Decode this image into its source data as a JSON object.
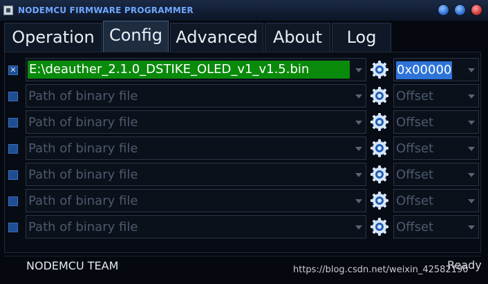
{
  "window": {
    "title": "NODEMCU FIRMWARE PROGRAMMER"
  },
  "tabs": [
    {
      "label": "Operation",
      "active": false
    },
    {
      "label": "Config",
      "active": true
    },
    {
      "label": "Advanced",
      "active": false
    },
    {
      "label": "About",
      "active": false
    },
    {
      "label": "Log",
      "active": false
    }
  ],
  "rows": [
    {
      "checked": true,
      "path": "E:\\deauther_2.1.0_DSTIKE_OLED_v1_v1.5.bin",
      "offset": "0x00000"
    },
    {
      "checked": false,
      "path": "Path of binary file",
      "offset": "Offset"
    },
    {
      "checked": false,
      "path": "Path of binary file",
      "offset": "Offset"
    },
    {
      "checked": false,
      "path": "Path of binary file",
      "offset": "Offset"
    },
    {
      "checked": false,
      "path": "Path of binary file",
      "offset": "Offset"
    },
    {
      "checked": false,
      "path": "Path of binary file",
      "offset": "Offset"
    },
    {
      "checked": false,
      "path": "Path of binary file",
      "offset": "Offset"
    }
  ],
  "status": {
    "team": "NODEMCU TEAM",
    "state": "Ready"
  },
  "watermark": "https://blog.csdn.net/weixin_42582190",
  "colors": {
    "path_fill": "#0a8a0a",
    "offset_fill": "#2e73d8",
    "title": "#6fa7ff"
  }
}
